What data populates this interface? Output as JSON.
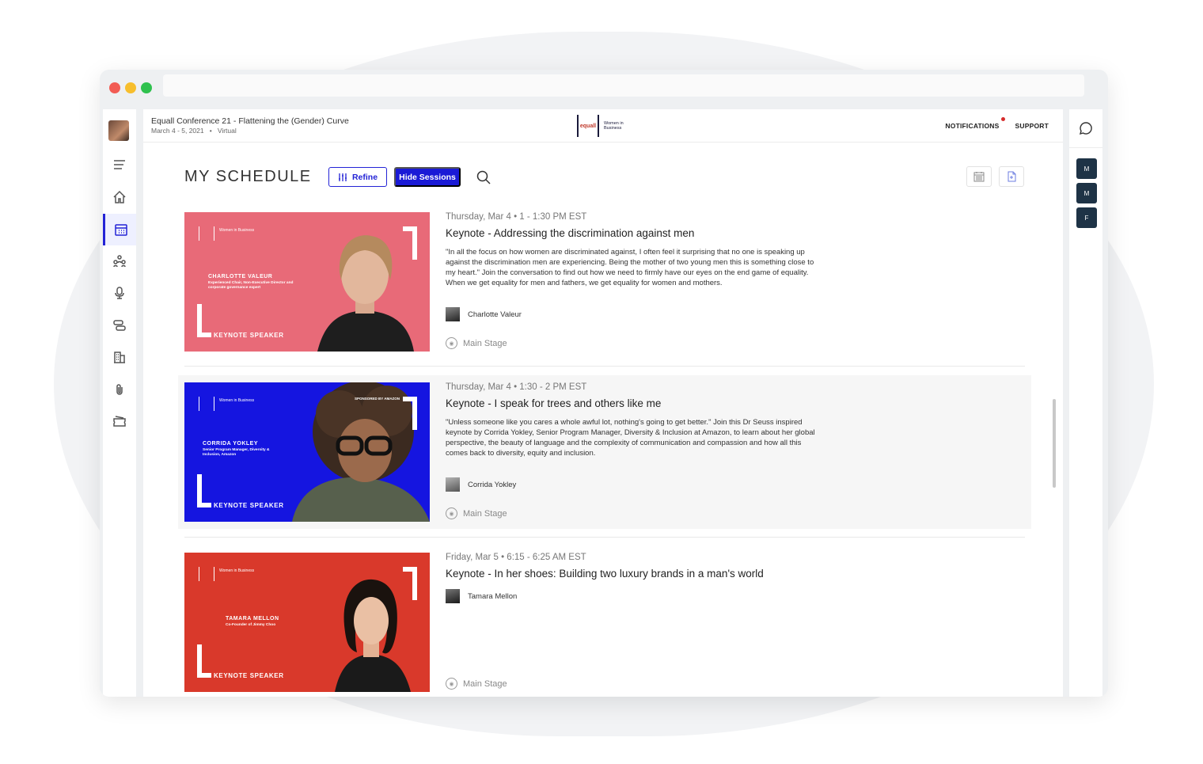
{
  "header": {
    "conference_title": "Equall Conference 21 - Flattening the (Gender) Curve",
    "conference_dates": "March 4 - 5, 2021",
    "conference_mode": "Virtual",
    "logo_text": "equall",
    "logo_subtext": "Women in Business",
    "notifications_label": "NOTIFICATIONS",
    "support_label": "SUPPORT"
  },
  "page": {
    "title": "MY SCHEDULE",
    "refine_label": "Refine",
    "hide_sessions_label": "Hide Sessions"
  },
  "sidebar": {
    "items": [
      "menu-icon",
      "home-icon",
      "calendar-icon",
      "people-icon",
      "microphone-icon",
      "sessions-icon",
      "building-icon",
      "attachment-icon",
      "ticket-icon"
    ],
    "active": "calendar-icon"
  },
  "sessions": [
    {
      "date": "Thursday, Mar 4 • 1 - 1:30 PM EST",
      "title": "Keynote - Addressing the discrimination against men",
      "description": "\"In all the focus on how women are discriminated against, I often feel it surprising that no one is speaking up against the discrimination men are experiencing. Being the mother of two young men this is something close to my heart.\" Join the conversation to find out how we need to firmly have our eyes on the end game of equality. When we get equality for men and fathers, we get equality for women and mothers.",
      "speaker": "Charlotte Valeur",
      "stage": "Main Stage",
      "banner_name": "CHARLOTTE VALEUR",
      "banner_role": "Experienced Chair, Non-Executive Director and corporate governance expert",
      "banner_label": "KEYNOTE SPEAKER",
      "banner_color": "#e86a78"
    },
    {
      "date": "Thursday, Mar 4 • 1:30 - 2 PM EST",
      "title": "Keynote - I speak for trees and others like me",
      "description": "\"Unless someone like you cares a whole awful lot, nothing's going to get better.\" Join this Dr Seuss inspired keynote by Corrida Yokley, Senior Program Manager, Diversity & Inclusion at Amazon, to learn about her global perspective, the beauty of language and the complexity of communication and compassion and how all this comes back to diversity, equity and inclusion.",
      "speaker": "Corrida Yokley",
      "stage": "Main Stage",
      "banner_name": "CORRIDA YOKLEY",
      "banner_role": "Senior Program Manager, Diversity & Inclusion, Amazon",
      "banner_label": "KEYNOTE SPEAKER",
      "banner_sponsor": "SPONSORED BY AMAZON",
      "banner_color": "#1515e0"
    },
    {
      "date": "Friday, Mar 5 • 6:15 - 6:25 AM EST",
      "title": "Keynote - In her shoes: Building two luxury brands in a man's world",
      "speaker": "Tamara Mellon",
      "stage": "Main Stage",
      "banner_name": "TAMARA MELLON",
      "banner_role": "Co-Founder of Jimmy Choo",
      "banner_label": "KEYNOTE SPEAKER",
      "banner_color": "#d9392b"
    }
  ],
  "right_panel": {
    "users": [
      "M",
      "M",
      "F"
    ]
  },
  "colors": {
    "accent": "#2323d6",
    "user_tile": "#1e3346"
  }
}
